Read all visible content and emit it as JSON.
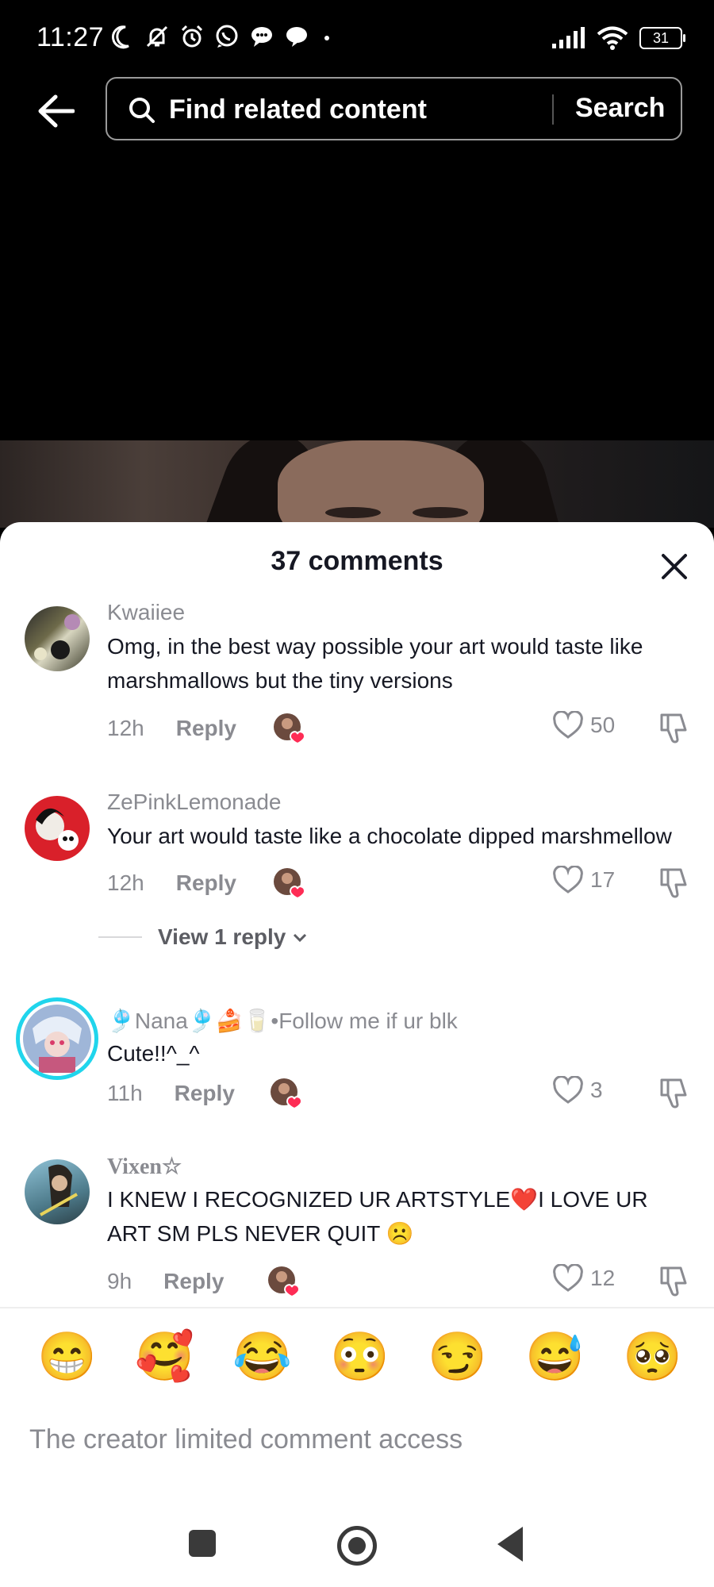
{
  "status_bar": {
    "time": "11:27",
    "battery": "31",
    "left_icons": [
      "moon-icon",
      "bell-off-icon",
      "alarm-icon",
      "whatsapp-icon",
      "chat-bubble-icon",
      "message-icon",
      "dot-icon"
    ],
    "right_icons": [
      "signal-icon",
      "wifi-icon",
      "battery-icon"
    ]
  },
  "search": {
    "placeholder": "Find related content",
    "button_label": "Search"
  },
  "comments_panel": {
    "title": "37 comments",
    "comments": [
      {
        "username": "Kwaiiee",
        "text": "Omg, in the best way possible your art would taste like marshmallows but the tiny versions",
        "time": "12h",
        "reply_label": "Reply",
        "likes": "50"
      },
      {
        "username": "ZePinkLemonade",
        "text": "Your art would taste like a chocolate dipped marshmellow",
        "time": "12h",
        "reply_label": "Reply",
        "likes": "17"
      },
      {
        "username": "🎐Nana🎐🍰🥛•Follow me if ur blk",
        "text": "Cute!!^_^",
        "time": "11h",
        "reply_label": "Reply",
        "likes": "3"
      },
      {
        "username": "Vixen☆",
        "text": "I KNEW I RECOGNIZED UR ARTSTYLE❤️I LOVE UR ART SM PLS NEVER QUIT ☹️",
        "time": "9h",
        "reply_label": "Reply",
        "likes": "12"
      }
    ],
    "view_replies_label": "View 1 reply"
  },
  "emoji_bar": [
    "😁",
    "🥰",
    "😂",
    "😳",
    "😏",
    "😅",
    "🥺"
  ],
  "comment_input_notice": "The creator limited comment access",
  "colors": {
    "text_primary": "#161823",
    "text_secondary": "#8a8b91",
    "like_red": "#fe2c55",
    "background_dark": "#000000"
  }
}
